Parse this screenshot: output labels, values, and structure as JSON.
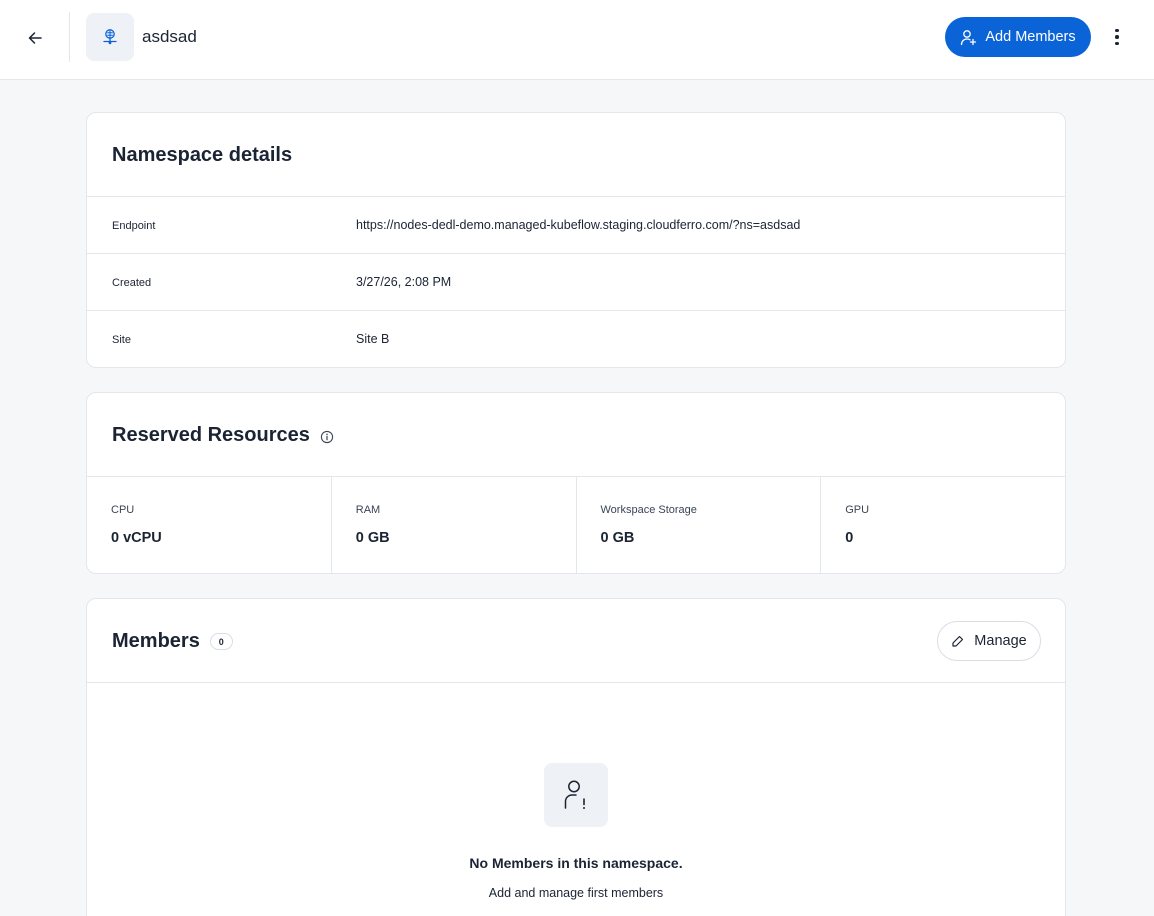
{
  "header": {
    "namespace_name": "asdsad",
    "add_members_label": "Add Members"
  },
  "namespace_details": {
    "title": "Namespace details",
    "rows": [
      {
        "label": "Endpoint",
        "value": "https://nodes-dedl-demo.managed-kubeflow.staging.cloudferro.com/?ns=asdsad"
      },
      {
        "label": "Created",
        "value": "3/27/26, 2:08 PM"
      },
      {
        "label": "Site",
        "value": "Site B"
      }
    ]
  },
  "reserved_resources": {
    "title": "Reserved Resources",
    "items": [
      {
        "label": "CPU",
        "value": "0 vCPU"
      },
      {
        "label": "RAM",
        "value": "0 GB"
      },
      {
        "label": "Workspace Storage",
        "value": "0 GB"
      },
      {
        "label": "GPU",
        "value": "0"
      }
    ]
  },
  "members": {
    "title": "Members",
    "count": "0",
    "manage_label": "Manage",
    "empty_title": "No Members in this namespace.",
    "empty_subtitle": "Add and manage first members"
  },
  "colors": {
    "primary": "#0b63d8",
    "background": "#f5f7f9",
    "text": "#1b2433",
    "border": "#e3e7ec"
  },
  "icons": {
    "back": "arrow-left-icon",
    "namespace": "network-node-icon",
    "add_members": "user-plus-icon",
    "more": "more-vertical-icon",
    "info": "info-icon",
    "manage": "edit-icon",
    "empty": "user-alert-icon"
  }
}
